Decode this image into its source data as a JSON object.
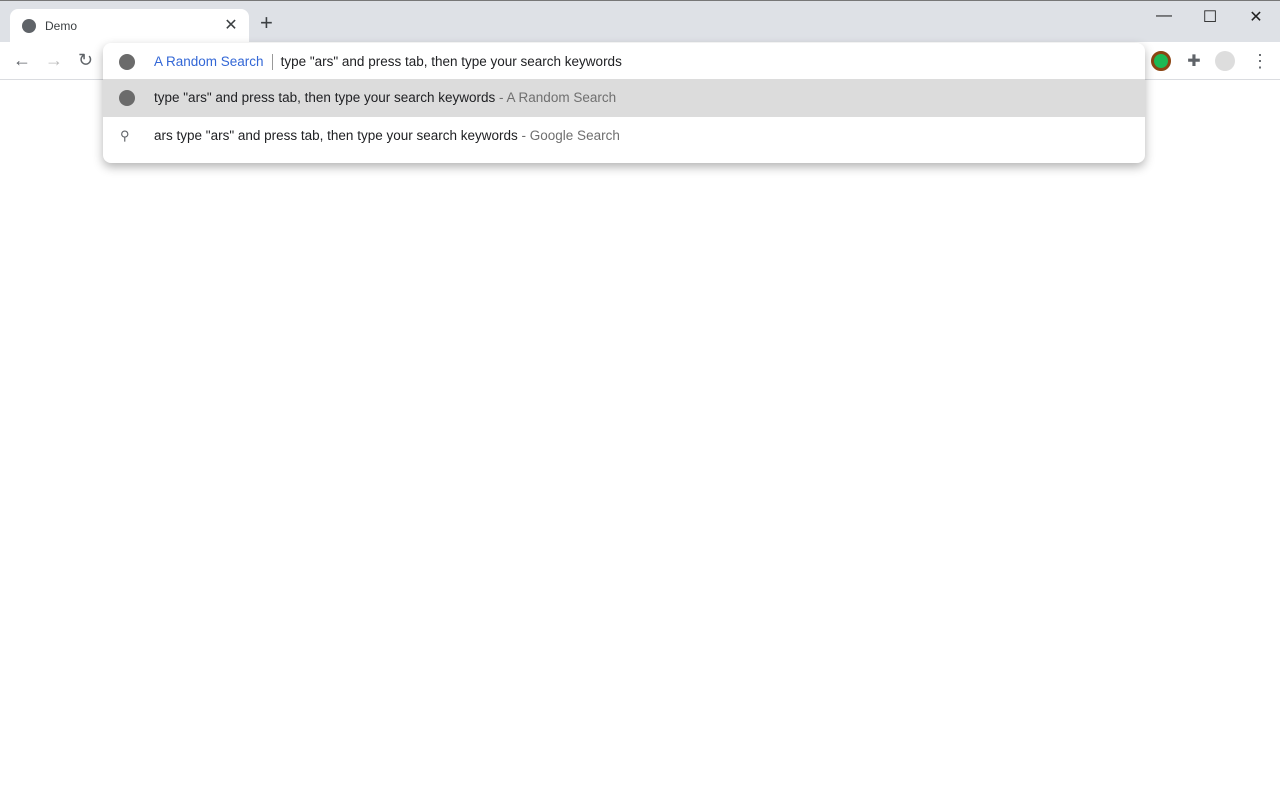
{
  "tab": {
    "title": "Demo",
    "favicon": "globe-icon"
  },
  "window": {
    "minimize": "—",
    "maximize": "☐",
    "close": "✕"
  },
  "nav": {
    "back": "←",
    "forward": "→",
    "reload": "↻"
  },
  "omnibox": {
    "keyword": "A Random Search",
    "text": "type \"ars\" and press tab, then type your search keywords"
  },
  "suggestions": [
    {
      "text": "type \"ars\" and press tab, then type your search keywords",
      "source": "- A Random Search",
      "icon": "random-search-icon"
    },
    {
      "text": "ars type \"ars\" and press tab, then type your search keywords",
      "source": "- Google Search",
      "icon": "search-icon"
    }
  ],
  "menu": "⋮"
}
